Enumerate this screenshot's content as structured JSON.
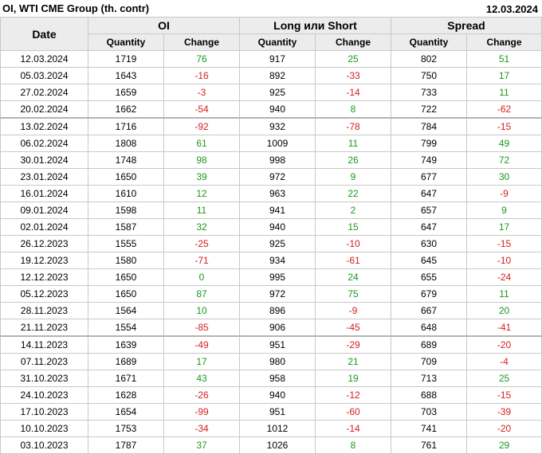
{
  "header": {
    "title": "OI, WTI CME Group (th. contr)",
    "date": "12.03.2024"
  },
  "table": {
    "date_header": "Date",
    "groups": [
      "OI",
      "Long или Short",
      "Spread"
    ],
    "sub_headers": [
      "Quantity",
      "Change",
      "Quantity",
      "Change",
      "Quantity",
      "Change"
    ],
    "colors": {
      "positive": "#1a9a1a",
      "negative": "#d42020"
    },
    "rows": [
      [
        "12.03.2024",
        "1719",
        "76",
        "917",
        "25",
        "802",
        "51"
      ],
      [
        "05.03.2024",
        "1643",
        "-16",
        "892",
        "-33",
        "750",
        "17"
      ],
      [
        "27.02.2024",
        "1659",
        "-3",
        "925",
        "-14",
        "733",
        "11"
      ],
      [
        "20.02.2024",
        "1662",
        "-54",
        "940",
        "8",
        "722",
        "-62"
      ],
      [
        "13.02.2024",
        "1716",
        "-92",
        "932",
        "-78",
        "784",
        "-15"
      ],
      [
        "06.02.2024",
        "1808",
        "61",
        "1009",
        "11",
        "799",
        "49"
      ],
      [
        "30.01.2024",
        "1748",
        "98",
        "998",
        "26",
        "749",
        "72"
      ],
      [
        "23.01.2024",
        "1650",
        "39",
        "972",
        "9",
        "677",
        "30"
      ],
      [
        "16.01.2024",
        "1610",
        "12",
        "963",
        "22",
        "647",
        "-9"
      ],
      [
        "09.01.2024",
        "1598",
        "11",
        "941",
        "2",
        "657",
        "9"
      ],
      [
        "02.01.2024",
        "1587",
        "32",
        "940",
        "15",
        "647",
        "17"
      ],
      [
        "26.12.2023",
        "1555",
        "-25",
        "925",
        "-10",
        "630",
        "-15"
      ],
      [
        "19.12.2023",
        "1580",
        "-71",
        "934",
        "-61",
        "645",
        "-10"
      ],
      [
        "12.12.2023",
        "1650",
        "0",
        "995",
        "24",
        "655",
        "-24"
      ],
      [
        "05.12.2023",
        "1650",
        "87",
        "972",
        "75",
        "679",
        "11"
      ],
      [
        "28.11.2023",
        "1564",
        "10",
        "896",
        "-9",
        "667",
        "20"
      ],
      [
        "21.11.2023",
        "1554",
        "-85",
        "906",
        "-45",
        "648",
        "-41"
      ],
      [
        "14.11.2023",
        "1639",
        "-49",
        "951",
        "-29",
        "689",
        "-20"
      ],
      [
        "07.11.2023",
        "1689",
        "17",
        "980",
        "21",
        "709",
        "-4"
      ],
      [
        "31.10.2023",
        "1671",
        "43",
        "958",
        "19",
        "713",
        "25"
      ],
      [
        "24.10.2023",
        "1628",
        "-26",
        "940",
        "-12",
        "688",
        "-15"
      ],
      [
        "17.10.2023",
        "1654",
        "-99",
        "951",
        "-60",
        "703",
        "-39"
      ],
      [
        "10.10.2023",
        "1753",
        "-34",
        "1012",
        "-14",
        "741",
        "-20"
      ],
      [
        "03.10.2023",
        "1787",
        "37",
        "1026",
        "8",
        "761",
        "29"
      ]
    ],
    "separator_before_rows": [
      4,
      17
    ]
  }
}
